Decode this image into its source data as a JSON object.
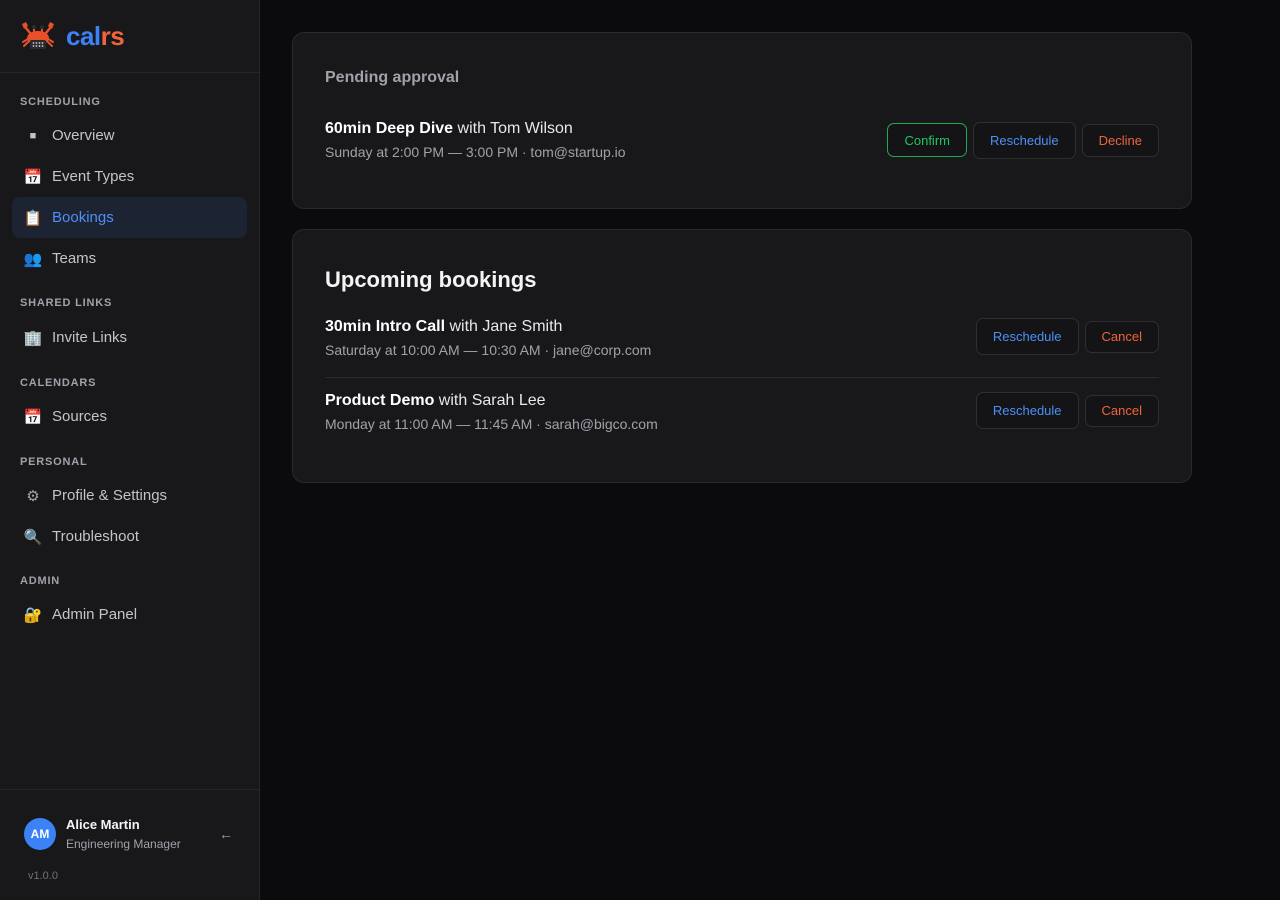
{
  "brand": {
    "name_part1": "cal",
    "name_part2": "rs",
    "logo_icon": "crab-icon"
  },
  "sidebar": {
    "sections": [
      {
        "label": "SCHEDULING",
        "items": [
          {
            "label": "Overview",
            "icon": "square-icon",
            "glyph": "■",
            "active": false
          },
          {
            "label": "Event Types",
            "icon": "calendar-icon",
            "glyph": "📅",
            "active": false
          },
          {
            "label": "Bookings",
            "icon": "clipboard-icon",
            "glyph": "📋",
            "active": true
          },
          {
            "label": "Teams",
            "icon": "people-icon",
            "glyph": "👥",
            "active": false
          }
        ]
      },
      {
        "label": "SHARED LINKS",
        "items": [
          {
            "label": "Invite Links",
            "icon": "office-building-icon",
            "glyph": "🏢",
            "active": false
          }
        ]
      },
      {
        "label": "CALENDARS",
        "items": [
          {
            "label": "Sources",
            "icon": "calendar-icon",
            "glyph": "📅",
            "active": false
          }
        ]
      },
      {
        "label": "PERSONAL",
        "items": [
          {
            "label": "Profile & Settings",
            "icon": "gear-icon",
            "glyph": "⚙",
            "active": false
          },
          {
            "label": "Troubleshoot",
            "icon": "magnifier-icon",
            "glyph": "🔍",
            "active": false
          }
        ]
      },
      {
        "label": "ADMIN",
        "items": [
          {
            "label": "Admin Panel",
            "icon": "lock-with-key-icon",
            "glyph": "🔐",
            "active": false
          }
        ]
      }
    ]
  },
  "user": {
    "initials": "AM",
    "name": "Alice Martin",
    "role": "Engineering Manager",
    "logout_glyph": "←",
    "version": "v1.0.0"
  },
  "pending": {
    "title": "Pending approval",
    "booking": {
      "event": "60min Deep Dive",
      "with_text": "with Tom Wilson",
      "details": "Sunday at 2:00 PM — 3:00 PM · tom@startup.io",
      "confirm_label": "Confirm",
      "reschedule_label": "Reschedule",
      "decline_label": "Decline"
    }
  },
  "upcoming": {
    "title": "Upcoming bookings",
    "bookings": [
      {
        "event": "30min Intro Call",
        "with_text": "with Jane Smith",
        "details": "Saturday at 10:00 AM — 10:30 AM · jane@corp.com",
        "reschedule_label": "Reschedule",
        "cancel_label": "Cancel"
      },
      {
        "event": "Product Demo",
        "with_text": "with Sarah Lee",
        "details": "Monday at 11:00 AM — 11:45 AM · sarah@bigco.com",
        "reschedule_label": "Reschedule",
        "cancel_label": "Cancel"
      }
    ]
  },
  "colors": {
    "accent_blue": "#3b82f6",
    "brand_orange": "#f0643c",
    "confirm_green": "#22c55e",
    "danger": "#f0643c"
  }
}
